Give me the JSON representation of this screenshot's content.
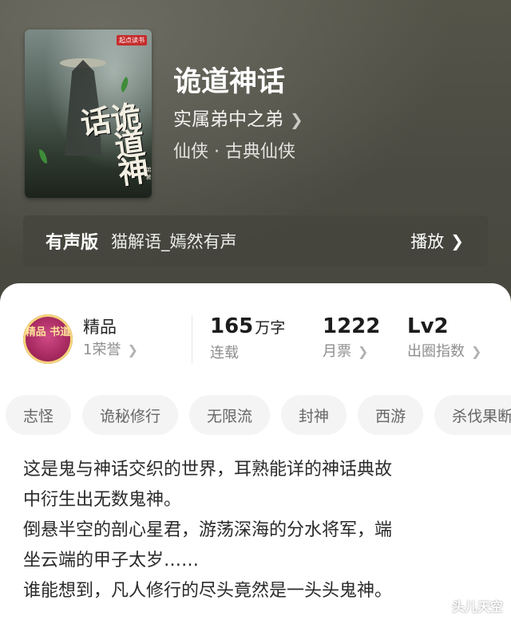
{
  "book": {
    "cover_title": "诡道神话",
    "cover_author": "实属弟中之弟 著",
    "cover_badge": "起点读书",
    "title": "诡道神话",
    "author": "实属弟中之弟",
    "genre": "仙侠 · 古典仙侠"
  },
  "audio": {
    "label": "有声版",
    "narrator": "猫解语_嫣然有声",
    "play_label": "播放"
  },
  "stats": {
    "premium_label": "精品",
    "honor_text": "1荣誉",
    "medal_text": "精品 书道",
    "word_count": "165",
    "word_unit": "万字",
    "status": "连载",
    "monthly_tickets": "1222",
    "monthly_label": "月票",
    "level": "Lv2",
    "level_label": "出圈指数"
  },
  "tags": [
    "志怪",
    "诡秘修行",
    "无限流",
    "封神",
    "西游",
    "杀伐果断"
  ],
  "description": [
    "这是鬼与神话交织的世界，耳熟能详的神话典故",
    "中衍生出无数鬼神。",
    "倒悬半空的剖心星君，游荡深海的分水将军，端",
    "坐云端的甲子太岁……",
    "谁能想到，凡人修行的尽头竟然是一头头鬼神。"
  ],
  "watermark": "头儿天空",
  "colors": {
    "accent_medal": "#a3275d",
    "card_bg": "#ffffff",
    "hero_bg": "#4b4b43"
  }
}
